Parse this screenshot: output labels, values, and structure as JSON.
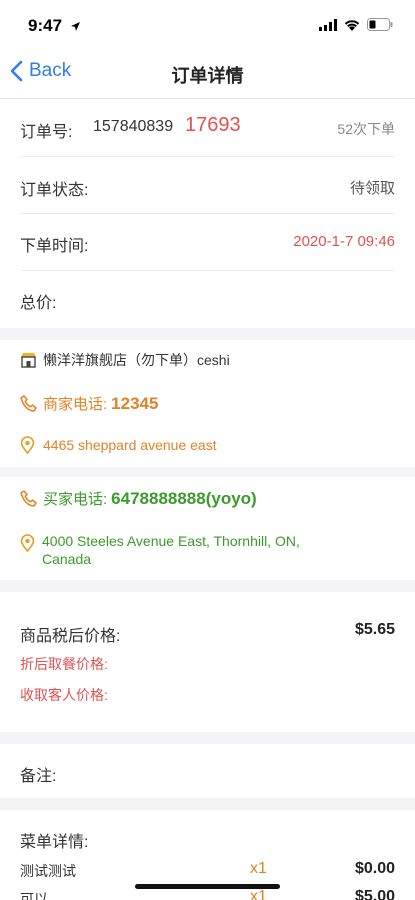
{
  "status": {
    "time": "9:47"
  },
  "nav": {
    "back_label": "Back",
    "title": "订单详情"
  },
  "order": {
    "number_label": "订单号:",
    "number_prefix": "157840839",
    "number_suffix": "17693",
    "count": "52次下单",
    "status_label": "订单状态:",
    "status_value": "待领取",
    "time_label": "下单时间:",
    "time_value": "2020-1-7 09:46",
    "total_label": "总价:"
  },
  "merchant": {
    "shop_name": "懒洋洋旗舰店（勿下单）ceshi",
    "phone_label": "商家电话:",
    "phone_value": "12345",
    "address": "4465 sheppard avenue east"
  },
  "buyer": {
    "phone_label": "买家电话:",
    "phone_value": "6478888888(yoyo)",
    "address_line1": "4000 Steeles Avenue East, Thornhill, ON,",
    "address_line2": "Canada"
  },
  "price": {
    "after_tax_label": "商品税后价格:",
    "after_tax_value": "$5.65",
    "discount_label": "折后取餐价格:",
    "collect_label": "收取客人价格:"
  },
  "note": {
    "label": "备注:"
  },
  "menu": {
    "label": "菜单详情:",
    "items": [
      {
        "name": "测试测试",
        "qty": "x1",
        "price": "$0.00"
      },
      {
        "name": "可以",
        "qty": "x1",
        "price": "$5.00"
      }
    ]
  },
  "colors": {
    "accent": "#2f7cf6",
    "red": "#e0524e",
    "orange": "#e08226",
    "green": "#3a9a2c"
  }
}
